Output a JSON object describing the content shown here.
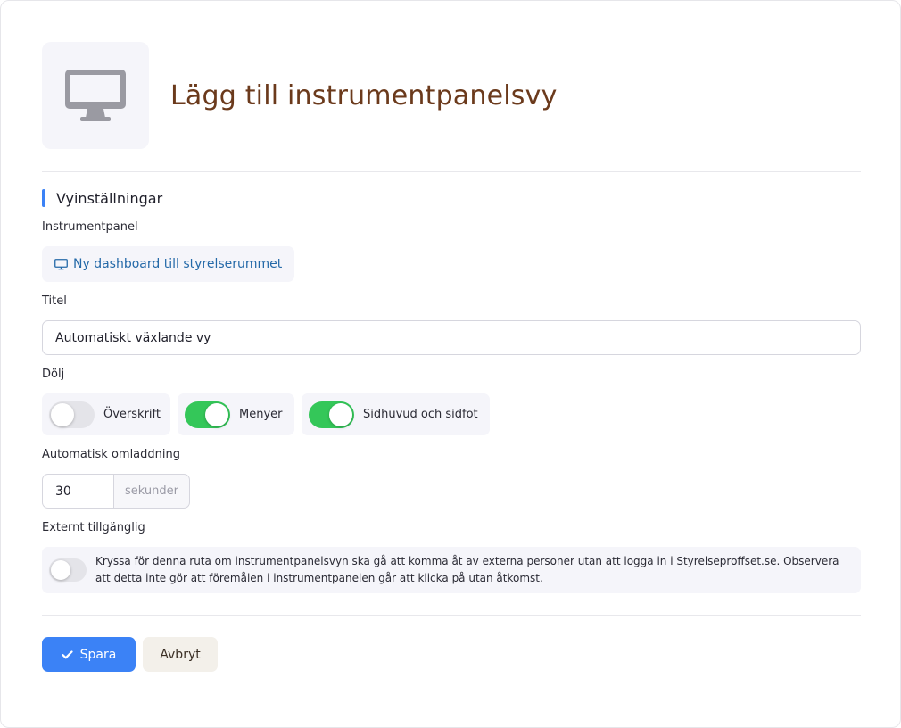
{
  "header": {
    "title": "Lägg till instrumentpanelsvy",
    "icon": "monitor-icon"
  },
  "section": {
    "title": "Vyinställningar"
  },
  "dashboard": {
    "label": "Instrumentpanel",
    "value": "Ny dashboard till styrelserummet",
    "icon": "monitor-icon"
  },
  "title_field": {
    "label": "Titel",
    "value": "Automatiskt växlande vy"
  },
  "hide": {
    "label": "Dölj",
    "toggles": [
      {
        "label": "Överskrift",
        "on": false
      },
      {
        "label": "Menyer",
        "on": true
      },
      {
        "label": "Sidhuvud och sidfot",
        "on": true
      }
    ]
  },
  "reload": {
    "label": "Automatisk omladdning",
    "value": "30",
    "unit": "sekunder"
  },
  "external": {
    "label": "Externt tillgänglig",
    "on": false,
    "text": "Kryssa för denna ruta om instrumentpanelsvyn ska gå att komma åt av externa personer utan att logga in i Styrelseproffset.se. Observera att detta inte gör att föremålen i instrumentpanelen går att klicka på utan åtkomst."
  },
  "actions": {
    "save_label": "Spara",
    "cancel_label": "Avbryt"
  },
  "colors": {
    "accent": "#3b82f6",
    "title": "#6b3a1c",
    "toggle_on": "#34c759",
    "link": "#2469a8"
  }
}
